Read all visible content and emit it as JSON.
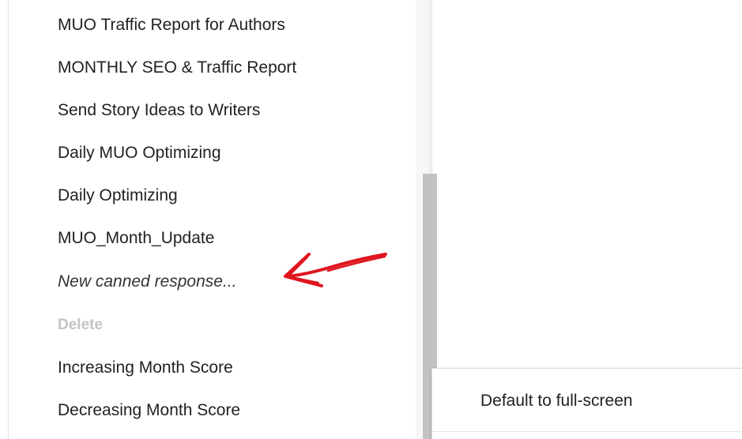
{
  "canned_menu": {
    "items": [
      {
        "label": "MUO Traffic Report for Authors",
        "style": "normal"
      },
      {
        "label": "MONTHLY SEO & Traffic Report",
        "style": "normal"
      },
      {
        "label": "Send Story Ideas to Writers",
        "style": "normal"
      },
      {
        "label": "Daily MUO Optimizing",
        "style": "normal"
      },
      {
        "label": "Daily Optimizing",
        "style": "normal"
      },
      {
        "label": "MUO_Month_Update",
        "style": "normal"
      },
      {
        "label": "New canned response...",
        "style": "italic"
      },
      {
        "label": "Delete",
        "style": "disabled"
      },
      {
        "label": "Increasing Month Score",
        "style": "normal"
      },
      {
        "label": "Decreasing Month Score",
        "style": "normal"
      }
    ]
  },
  "submenu": {
    "default_full_screen_label": "Default to full-screen"
  },
  "annotation": {
    "arrow_color": "#e0141e",
    "icon": "red-arrow-annotation"
  },
  "colors": {
    "text": "#222222",
    "disabled_text": "#c4c4c4",
    "scroll_thumb": "#c2c2c2"
  }
}
